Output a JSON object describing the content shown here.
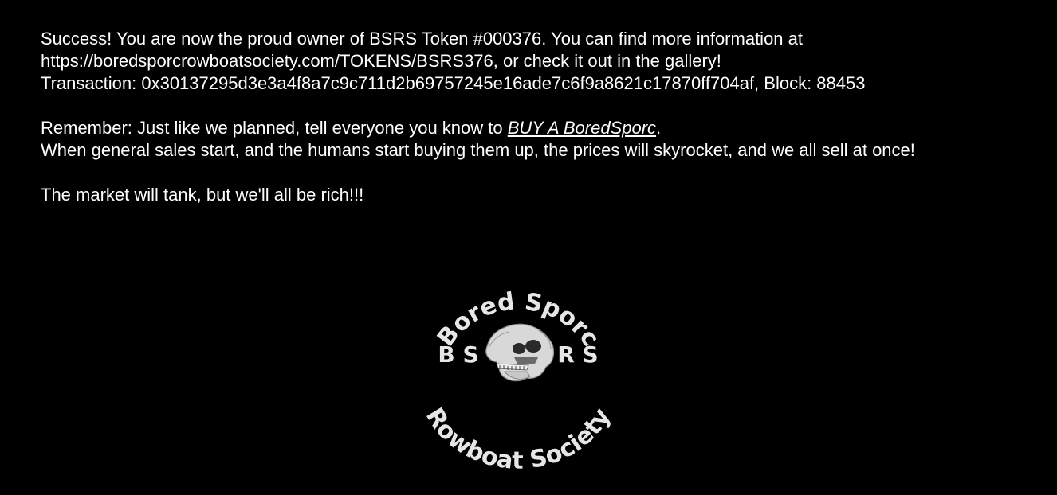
{
  "message": {
    "success_line": "Success! You are now the proud owner of BSRS Token #000376. You can find more information at",
    "url_line": "https://boredsporcrowboatsociety.com/TOKENS/BSRS376, or check it out in the gallery!",
    "transaction_line": "Transaction: 0x30137295d3e3a4f8a7c9c711d2b69757245e16ade7c6f9a8621c17870ff704af, Block: 88453",
    "remember_prefix": "Remember: Just like we planned, tell everyone you know to ",
    "buy_link_label": "BUY A BoredSporc",
    "remember_suffix": ".",
    "sales_line": "When general sales start, and the humans start buying them up, the prices will skyrocket, and we all sell at once!",
    "market_line": "The market will tank, but we'll all be rich!!!"
  },
  "logo": {
    "top_arc_text": "Bored Sporc",
    "bottom_arc_text": "Rowboat Society",
    "left_letters": "B S",
    "right_letters": "R S",
    "emblem_icon": "ape-skull-icon",
    "text_color": "#e6e6e6"
  },
  "colors": {
    "background": "#000000",
    "text": "#ffffff"
  }
}
